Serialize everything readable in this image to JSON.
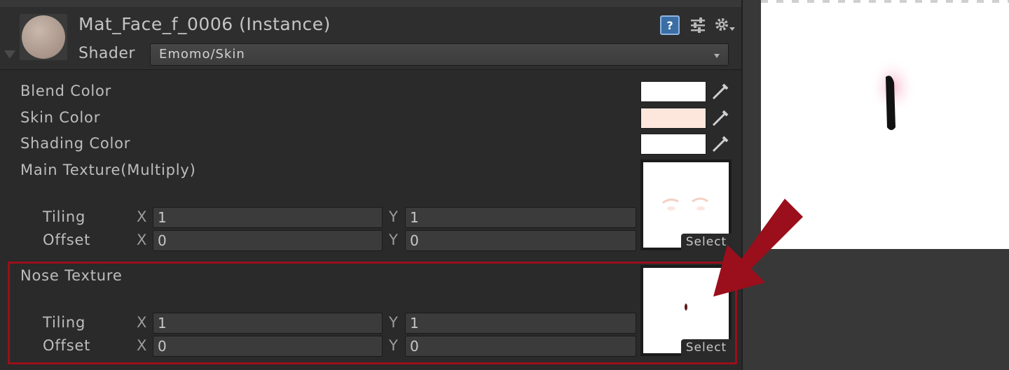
{
  "material": {
    "title": "Mat_Face_f_0006 (Instance)",
    "shader_label": "Shader",
    "shader_value": "Emomo/Skin"
  },
  "properties": {
    "blend_color": {
      "label": "Blend Color",
      "color": "#ffffff"
    },
    "skin_color": {
      "label": "Skin Color",
      "color": "#fde6dc"
    },
    "shading_color": {
      "label": "Shading Color",
      "color": "#ffffff"
    },
    "main_texture": {
      "label": "Main Texture(Multiply)",
      "tiling_label": "Tiling",
      "offset_label": "Offset",
      "x_label": "X",
      "y_label": "Y",
      "tiling_x": "1",
      "tiling_y": "1",
      "offset_x": "0",
      "offset_y": "0",
      "select_label": "Select"
    },
    "nose_texture": {
      "label": "Nose Texture",
      "tiling_label": "Tiling",
      "offset_label": "Offset",
      "x_label": "X",
      "y_label": "Y",
      "tiling_x": "1",
      "tiling_y": "1",
      "offset_x": "0",
      "offset_y": "0",
      "select_label": "Select"
    }
  },
  "header_icons": {
    "help_glyph": "?",
    "help": "help-icon",
    "presets": "sliders-icon",
    "settings": "gear-icon"
  },
  "colors": {
    "highlight": "#9a0f1b",
    "arrow": "#9a0f1b"
  }
}
